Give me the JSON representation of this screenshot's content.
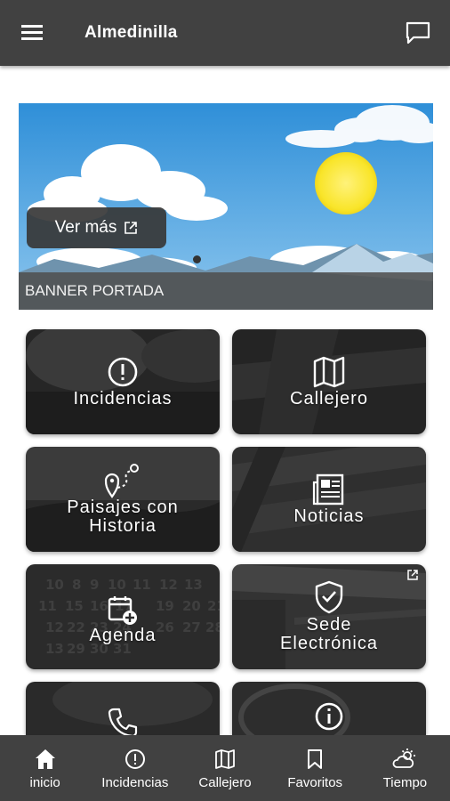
{
  "header": {
    "title": "Almedinilla"
  },
  "banner": {
    "button_label": "Ver más",
    "caption": "BANNER PORTADA"
  },
  "tiles": [
    {
      "label_line1": "Incidencias",
      "label_line2": ""
    },
    {
      "label_line1": "Callejero",
      "label_line2": ""
    },
    {
      "label_line1": "Paisajes con",
      "label_line2": "Historia"
    },
    {
      "label_line1": "Noticias",
      "label_line2": ""
    },
    {
      "label_line1": "Agenda",
      "label_line2": ""
    },
    {
      "label_line1": "Sede",
      "label_line2": "Electrónica"
    }
  ],
  "nav": [
    {
      "label": "inicio",
      "icon": "home-icon"
    },
    {
      "label": "Incidencias",
      "icon": "alert-circle-icon"
    },
    {
      "label": "Callejero",
      "icon": "map-icon"
    },
    {
      "label": "Favoritos",
      "icon": "bookmark-icon"
    },
    {
      "label": "Tiempo",
      "icon": "weather-icon"
    }
  ],
  "colors": {
    "bar": "#414141",
    "tile": "#2a2a2a",
    "sky": "#4ea3e3",
    "sun": "#fbe92f"
  }
}
